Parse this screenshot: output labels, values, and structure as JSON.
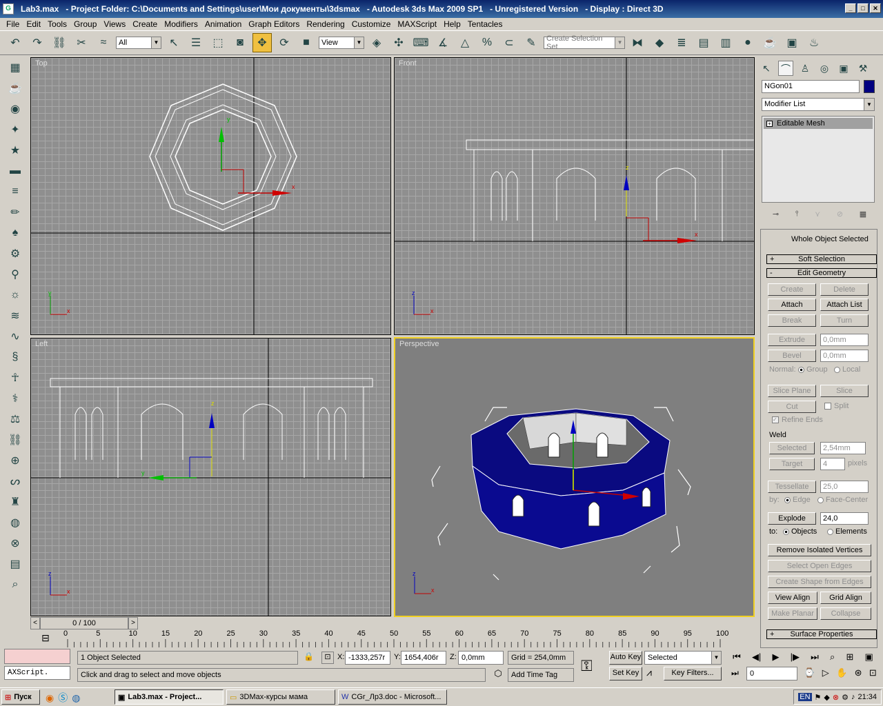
{
  "window": {
    "file": "Lab3.max",
    "project": "- Project Folder: C:\\Documents and Settings\\user\\Мои документы\\3dsmax",
    "app": "- Autodesk 3ds Max  2009 SP1",
    "version": "- Unregistered Version",
    "display": "- Display : Direct 3D"
  },
  "menu": [
    "File",
    "Edit",
    "Tools",
    "Group",
    "Views",
    "Create",
    "Modifiers",
    "Animation",
    "Graph Editors",
    "Rendering",
    "Customize",
    "MAXScript",
    "Help",
    "Tentacles"
  ],
  "toolbar": {
    "filter_value": "All",
    "ref_coord_value": "View",
    "selection_set_placeholder": "Create Selection Set"
  },
  "viewports": {
    "top": "Top",
    "front": "Front",
    "left": "Left",
    "perspective": "Perspective"
  },
  "panel": {
    "object_name": "NGon01",
    "object_color": "#000080",
    "modifier_list": "Modifier List",
    "stack_item": "Editable Mesh",
    "whole_object": "Whole Object Selected",
    "soft_selection": "Soft Selection",
    "edit_geometry": "Edit Geometry",
    "create": "Create",
    "delete": "Delete",
    "attach": "Attach",
    "attach_list": "Attach List",
    "break": "Break",
    "turn": "Turn",
    "extrude": "Extrude",
    "extrude_val": "0,0mm",
    "bevel": "Bevel",
    "bevel_val": "0,0mm",
    "normal": "Normal:",
    "group": "Group",
    "local": "Local",
    "slice_plane": "Slice Plane",
    "slice": "Slice",
    "cut": "Cut",
    "split": "Split",
    "refine_ends": "Refine Ends",
    "weld": "Weld",
    "weld_selected": "Selected",
    "weld_selected_val": "2,54mm",
    "weld_target": "Target",
    "weld_target_val": "4",
    "pixels": "pixels",
    "tessellate": "Tessellate",
    "tess_val": "25,0",
    "by": "by:",
    "edge": "Edge",
    "face_center": "Face-Center",
    "explode": "Explode",
    "explode_val": "24,0",
    "to": "to:",
    "objects": "Objects",
    "elements": "Elements",
    "remove_isolated": "Remove Isolated Vertices",
    "select_open_edges": "Select Open Edges",
    "create_shape": "Create Shape from Edges",
    "view_align": "View Align",
    "grid_align": "Grid Align",
    "make_planar": "Make Planar",
    "collapse": "Collapse",
    "surface_props": "Surface Properties"
  },
  "timeline": {
    "frame": "0 / 100",
    "ticks": [
      "0",
      "5",
      "10",
      "15",
      "20",
      "25",
      "30",
      "35",
      "40",
      "45",
      "50",
      "55",
      "60",
      "65",
      "70",
      "75",
      "80",
      "85",
      "90",
      "95",
      "100"
    ]
  },
  "status": {
    "script_label": "AXScript.",
    "selected_count": "1 Object Selected",
    "prompt": "Click and drag to select and move objects",
    "x_label": "X:",
    "x_val": "-1333,257r",
    "y_label": "Y:",
    "y_val": "1654,406r",
    "z_label": "Z:",
    "z_val": "0,0mm",
    "grid": "Grid = 254,0mm",
    "add_time_tag": "Add Time Tag",
    "auto_key": "Auto Key",
    "set_key": "Set Key",
    "key_mode": "Selected",
    "key_filters": "Key Filters...",
    "frame_val": "0"
  },
  "taskbar": {
    "start": "Пуск",
    "tasks": [
      "Lab3.max   - Project...",
      "3DMax-курсы мама",
      "CGr_Лр3.doc - Microsoft..."
    ],
    "lang": "EN",
    "clock": "21:34"
  }
}
